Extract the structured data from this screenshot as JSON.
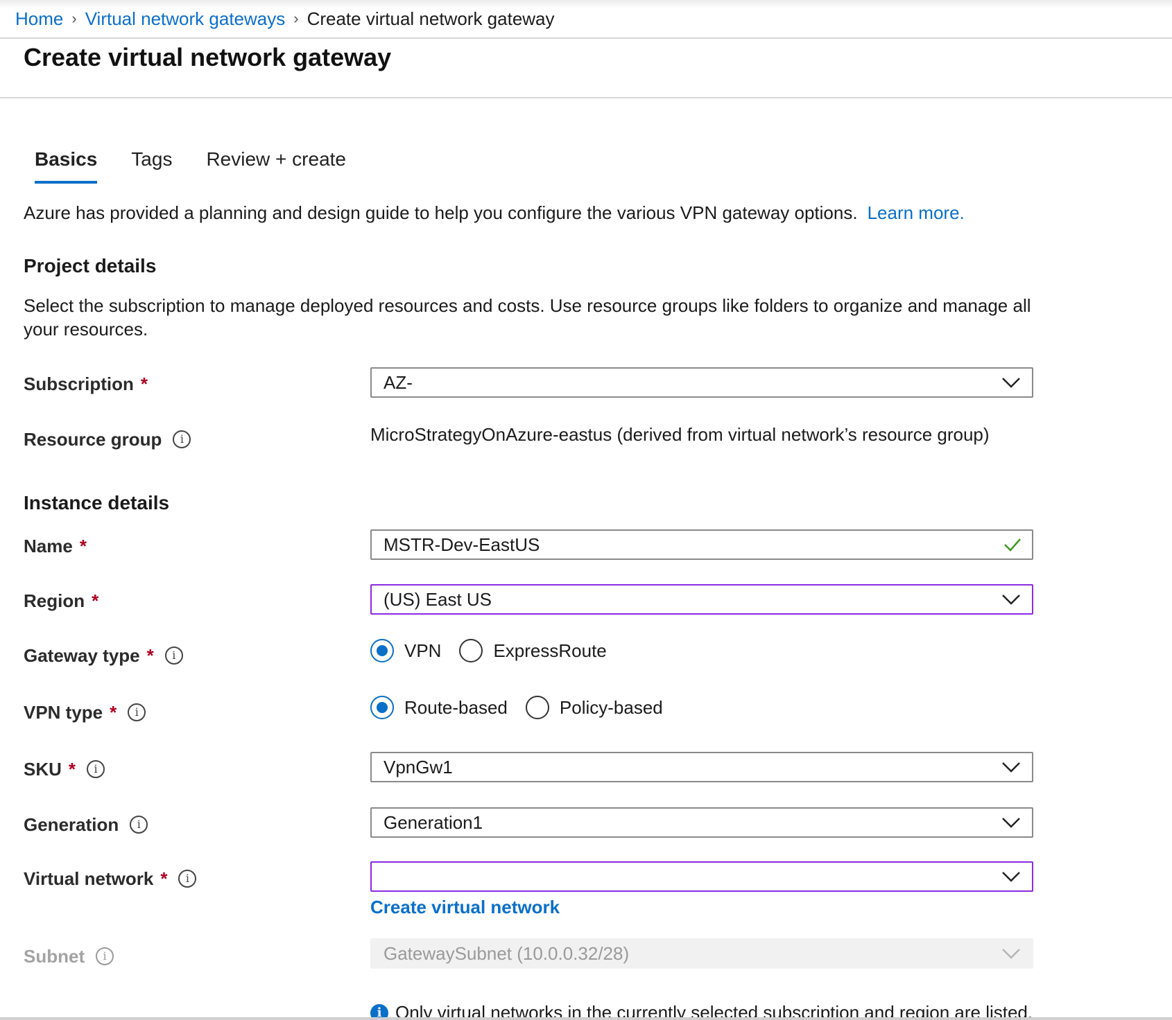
{
  "breadcrumb": {
    "home": "Home",
    "gateways": "Virtual network gateways",
    "current": "Create virtual network gateway"
  },
  "page_title": "Create virtual network gateway",
  "tabs": [
    "Basics",
    "Tags",
    "Review + create"
  ],
  "guide": {
    "text": "Azure has provided a planning and design guide to help you configure the various VPN gateway options.",
    "link": "Learn more."
  },
  "project": {
    "heading": "Project details",
    "description": "Select the subscription to manage deployed resources and costs. Use resource groups like folders to organize and manage all your resources.",
    "subscription_label": "Subscription",
    "subscription_value": "AZ-",
    "resource_group_label": "Resource group",
    "resource_group_value": "MicroStrategyOnAzure-eastus (derived from virtual network’s resource group)"
  },
  "instance": {
    "heading": "Instance details",
    "name_label": "Name",
    "name_value": "MSTR-Dev-EastUS",
    "region_label": "Region",
    "region_value": "(US) East US",
    "gateway_type_label": "Gateway type",
    "gateway_type_options": [
      "VPN",
      "ExpressRoute"
    ],
    "vpn_type_label": "VPN type",
    "vpn_type_options": [
      "Route-based",
      "Policy-based"
    ],
    "sku_label": "SKU",
    "sku_value": "VpnGw1",
    "generation_label": "Generation",
    "generation_value": "Generation1",
    "vnet_label": "Virtual network",
    "vnet_value": "",
    "create_vnet_link": "Create virtual network",
    "subnet_label": "Subnet",
    "subnet_value": "GatewaySubnet (10.0.0.32/28)",
    "note": "Only virtual networks in the currently selected subscription and region are listed."
  },
  "required_marker": "*",
  "info_glyph": "i",
  "colors": {
    "accent": "#0a6fc9",
    "focus_border": "#8a2be2",
    "required": "#b00020",
    "valid_check": "#3c9a1e"
  }
}
